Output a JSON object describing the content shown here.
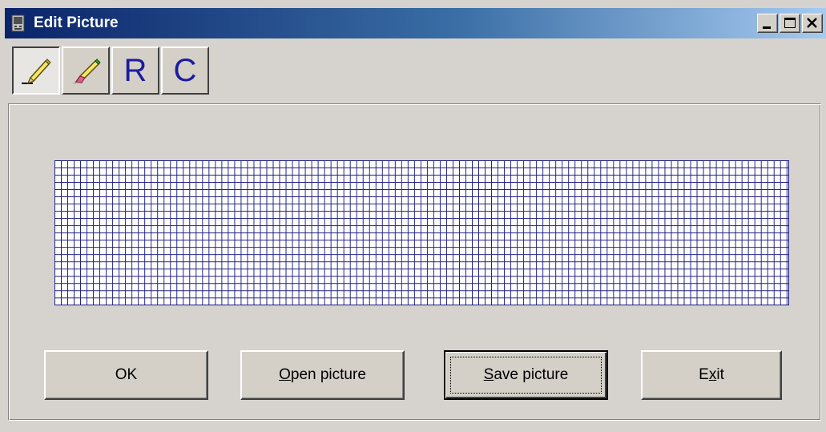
{
  "window": {
    "title": "Edit Picture",
    "icon": "pda-icon",
    "controls": [
      "minimize-icon",
      "maximize-icon",
      "close-icon"
    ]
  },
  "toolbar": {
    "tools": [
      {
        "name": "pencil-tool",
        "icon": "pencil-icon",
        "pressed": true
      },
      {
        "name": "eraser-tool",
        "icon": "eraser-icon",
        "pressed": false
      },
      {
        "name": "r-tool",
        "label": "R"
      },
      {
        "name": "c-tool",
        "label": "C"
      }
    ]
  },
  "grid": {
    "columns": 114,
    "rows": 20,
    "line_color": "#1a1a80",
    "background": "#ffffff"
  },
  "buttons": {
    "ok": {
      "label": "OK"
    },
    "open": {
      "prefix": "",
      "mnemonic": "O",
      "suffix": "pen picture"
    },
    "save": {
      "prefix": "",
      "mnemonic": "S",
      "suffix": "ave picture",
      "default": true
    },
    "exit": {
      "prefix": "E",
      "mnemonic": "x",
      "suffix": "it"
    }
  },
  "colors": {
    "titlebar_start": "#0a246a",
    "titlebar_end": "#a6caf0",
    "face": "#d4d0c8",
    "tool_letter": "#1c1ca0"
  }
}
